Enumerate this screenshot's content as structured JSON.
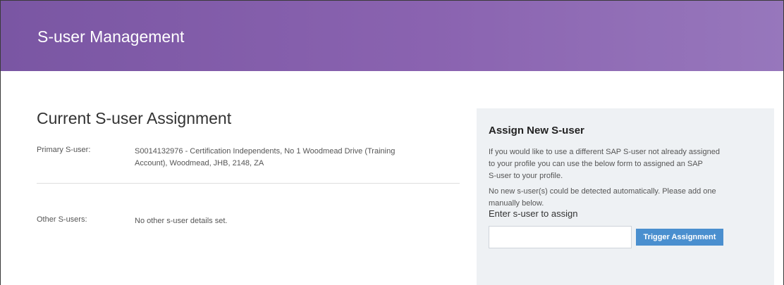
{
  "header": {
    "title": "S-user Management"
  },
  "current_assignment": {
    "title": "Current S-user Assignment",
    "primary": {
      "label": "Primary S-user:",
      "value_line1": "S0014132976 - Certification Independents, No 1 Woodmead Drive (Training",
      "value_line2": "Account), Woodmead, JHB, 2148, ZA"
    },
    "others": {
      "label": "Other S-users:",
      "value": "No other s-user details set."
    }
  },
  "assign_panel": {
    "title": "Assign New S-user",
    "description_lines": [
      "If you would like to use a different SAP S-user not already assigned",
      "to your profile you can use the below form to assigned an SAP",
      "S-user to your profile."
    ],
    "notice_lines": [
      "No new s-user(s) could be detected automatically. Please add one",
      "manually below."
    ],
    "input_label": "Enter s-user to assign",
    "input_value": "",
    "input_placeholder": "",
    "button_label": "Trigger Assignment"
  },
  "colors": {
    "header_start": "#7a56a3",
    "header_end": "#9777bc",
    "panel_background": "#eef1f4",
    "button_background": "#4a8fcf"
  }
}
